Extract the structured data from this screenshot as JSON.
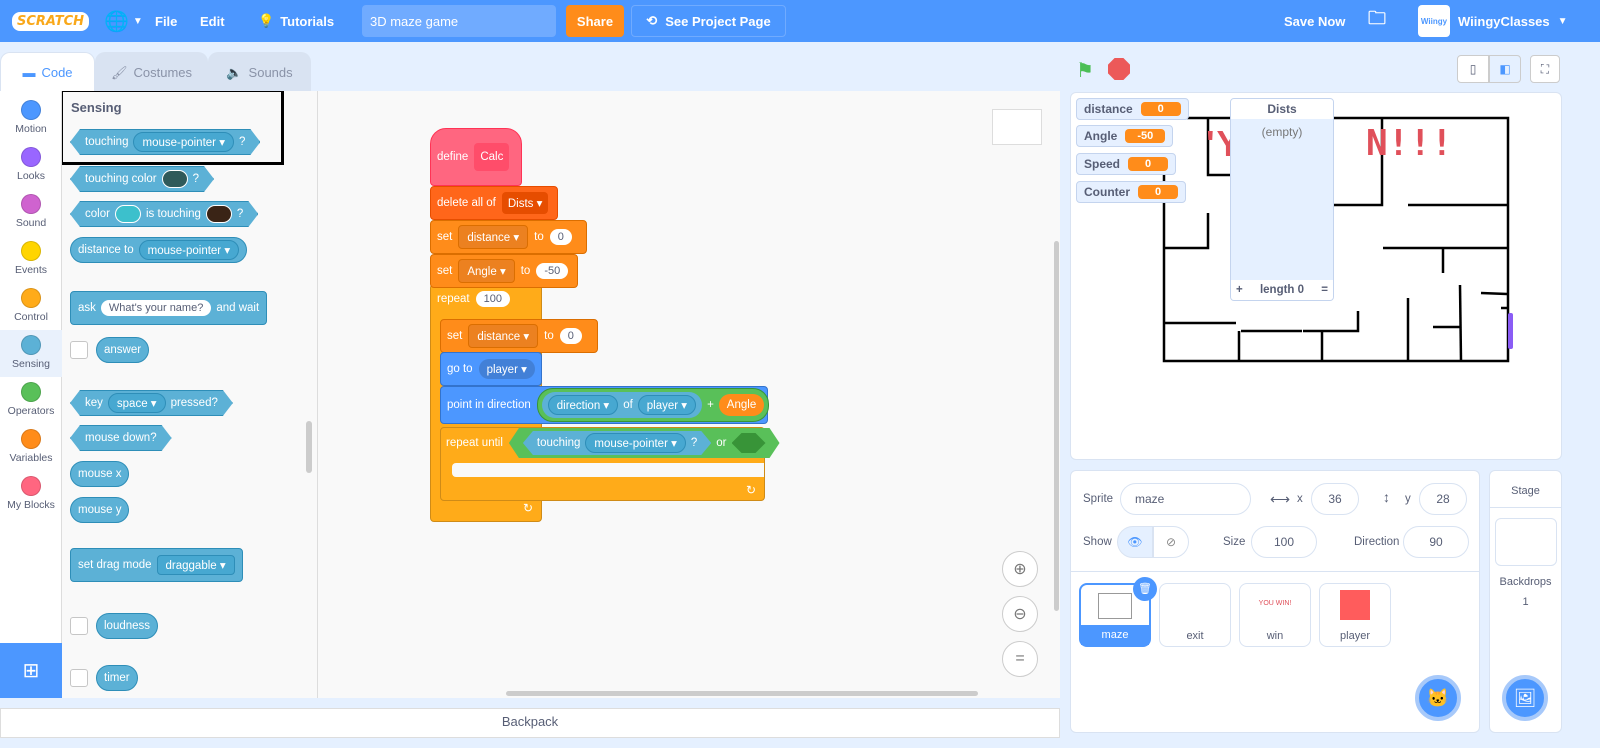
{
  "menu": {
    "logo": "SCRATCH",
    "file": "File",
    "edit": "Edit",
    "tutorials": "Tutorials",
    "project_title": "3D maze game",
    "share": "Share",
    "see_project_page": "See Project Page",
    "save_now": "Save Now",
    "username": "WiingyClasses",
    "avatar_text": "Wiingy"
  },
  "tabs": [
    {
      "label": "Code"
    },
    {
      "label": "Costumes"
    },
    {
      "label": "Sounds"
    }
  ],
  "categories": [
    {
      "label": "Motion",
      "color": "#4c97ff"
    },
    {
      "label": "Looks",
      "color": "#9966ff"
    },
    {
      "label": "Sound",
      "color": "#cf63cf"
    },
    {
      "label": "Events",
      "color": "#ffd500"
    },
    {
      "label": "Control",
      "color": "#ffab19"
    },
    {
      "label": "Sensing",
      "color": "#5cb1d6"
    },
    {
      "label": "Operators",
      "color": "#59c059"
    },
    {
      "label": "Variables",
      "color": "#ff8c1a"
    },
    {
      "label": "My Blocks",
      "color": "#ff6680"
    }
  ],
  "palette": {
    "heading": "Sensing",
    "touching": "touching",
    "mouse_pointer": "mouse-pointer",
    "q": "?",
    "touching_color": "touching color",
    "color": "color",
    "is_touching": "is touching",
    "distance_to": "distance to",
    "ask": "ask",
    "ask_default": "What's your name?",
    "and_wait": "and wait",
    "answer": "answer",
    "key": "key",
    "space": "space",
    "pressed": "pressed?",
    "mouse_down": "mouse down?",
    "mouse_x": "mouse x",
    "mouse_y": "mouse y",
    "set_drag_mode": "set drag mode",
    "draggable": "draggable",
    "loudness": "loudness",
    "timer": "timer"
  },
  "script": {
    "define": "define",
    "calc": "Calc",
    "delete_all_of": "delete all of",
    "dists": "Dists",
    "set": "set",
    "to": "to",
    "distance": "distance",
    "zero": "0",
    "angle": "Angle",
    "neg50": "-50",
    "repeat": "repeat",
    "hundred": "100",
    "go_to": "go to",
    "player": "player",
    "point_in_direction": "point in direction",
    "direction": "direction",
    "of": "of",
    "plus": "+",
    "repeat_until": "repeat until",
    "or": "or"
  },
  "backpack": "Backpack",
  "monitors": [
    {
      "name": "distance",
      "value": "0"
    },
    {
      "name": "Angle",
      "value": "-50"
    },
    {
      "name": "Speed",
      "value": "0"
    },
    {
      "name": "Counter",
      "value": "0"
    }
  ],
  "list_monitor": {
    "title": "Dists",
    "empty": "(empty)",
    "add": "+",
    "length": "length 0",
    "resize": "="
  },
  "stage_text": "N!!!",
  "sprite_info": {
    "sprite_label": "Sprite",
    "sprite_name": "maze",
    "x_label": "x",
    "x": "36",
    "y_label": "y",
    "y": "28",
    "show_label": "Show",
    "size_label": "Size",
    "size": "100",
    "direction_label": "Direction",
    "direction": "90"
  },
  "sprites": [
    {
      "name": "maze",
      "selected": true
    },
    {
      "name": "exit"
    },
    {
      "name": "win",
      "thumb_text": "YOU WIN!"
    },
    {
      "name": "player"
    }
  ],
  "stage_panel": {
    "title": "Stage",
    "backdrops_label": "Backdrops",
    "backdrops": "1"
  }
}
